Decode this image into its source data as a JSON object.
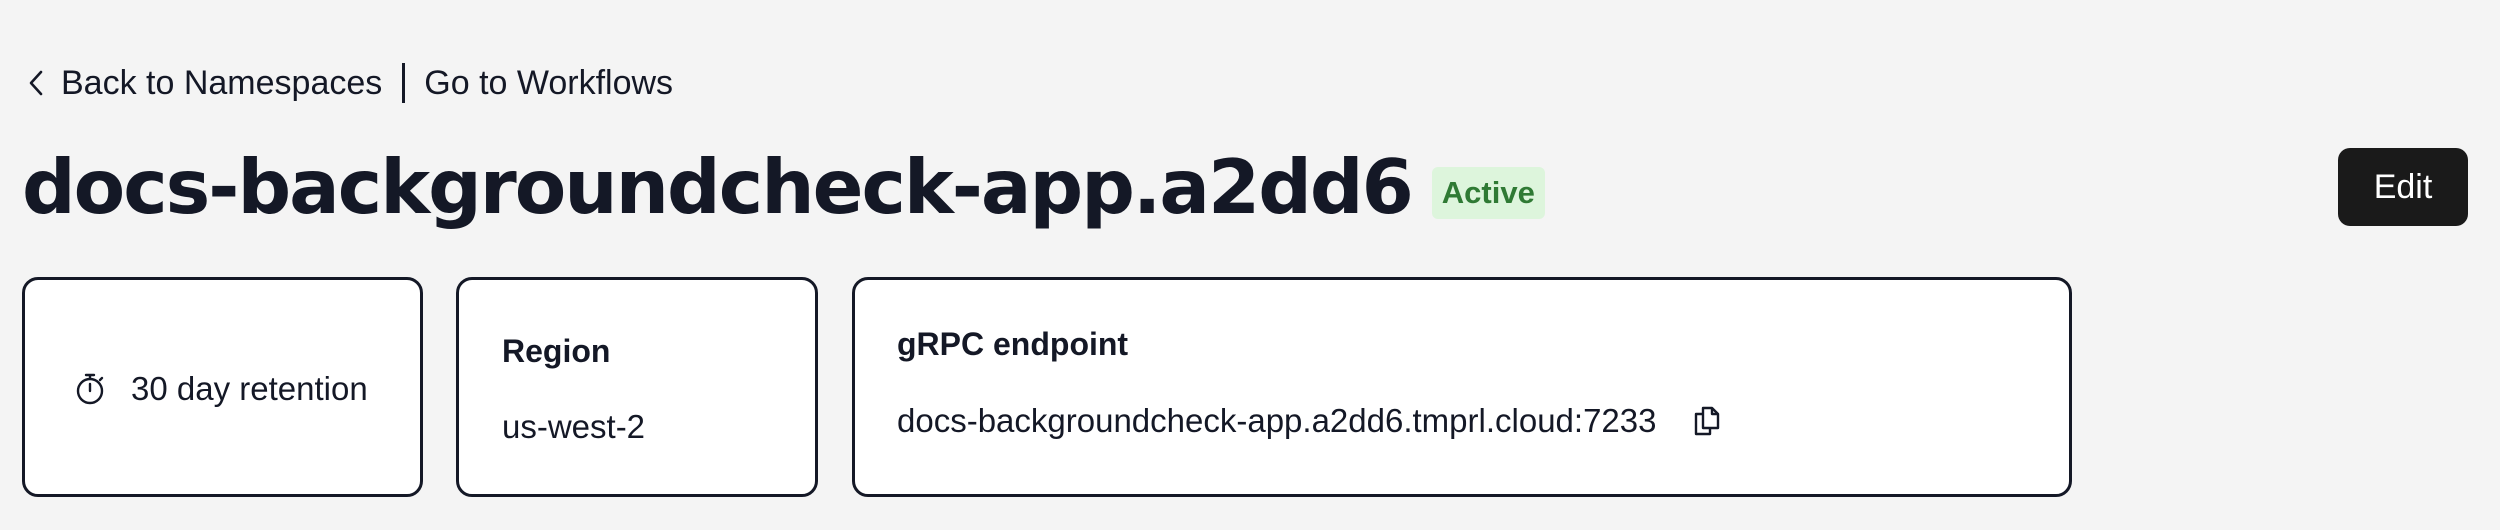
{
  "breadcrumb": {
    "back_label": "Back to Namespaces",
    "back_icon": "chevron-left-icon",
    "workflows_label": "Go to Workflows"
  },
  "header": {
    "title": "docs-backgroundcheck-app.a2dd6",
    "status": "Active",
    "status_color": "#2f7a34",
    "status_bg": "#ddf5dc",
    "edit_label": "Edit"
  },
  "cards": {
    "retention": {
      "icon": "stopwatch-icon",
      "text": "30 day retention"
    },
    "region": {
      "heading": "Region",
      "value": "us-west-2"
    },
    "grpc": {
      "heading": "gRPC endpoint",
      "value": "docs-backgroundcheck-app.a2dd6.tmprl.cloud:7233",
      "icon": "copy-icon"
    }
  }
}
